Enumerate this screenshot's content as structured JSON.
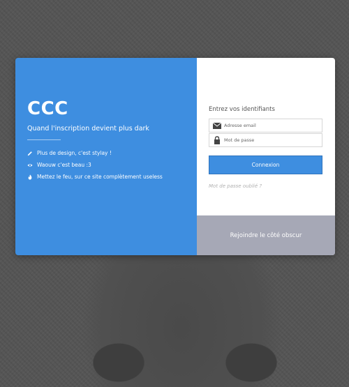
{
  "brand": {
    "title": "CCC",
    "tagline": "Quand l'inscription devient plus dark"
  },
  "features": [
    {
      "icon": "pencil-icon",
      "text": "Plus de design, c'est stylay !"
    },
    {
      "icon": "eye-icon",
      "text": "Waouw c'est beau :3"
    },
    {
      "icon": "fire-icon",
      "text": "Mettez le feu, sur ce site complètement useless"
    }
  ],
  "login": {
    "heading": "Entrez vos identifiants",
    "email_placeholder": "Adresse email",
    "password_placeholder": "Mot de passe",
    "submit_label": "Connexion",
    "forgot_label": "Mot de passe oublié ?",
    "join_label": "Rejoindre le côté obscur"
  },
  "colors": {
    "accent": "#3e8ee0",
    "join_panel": "#a6a8b6",
    "background": "#565656"
  }
}
